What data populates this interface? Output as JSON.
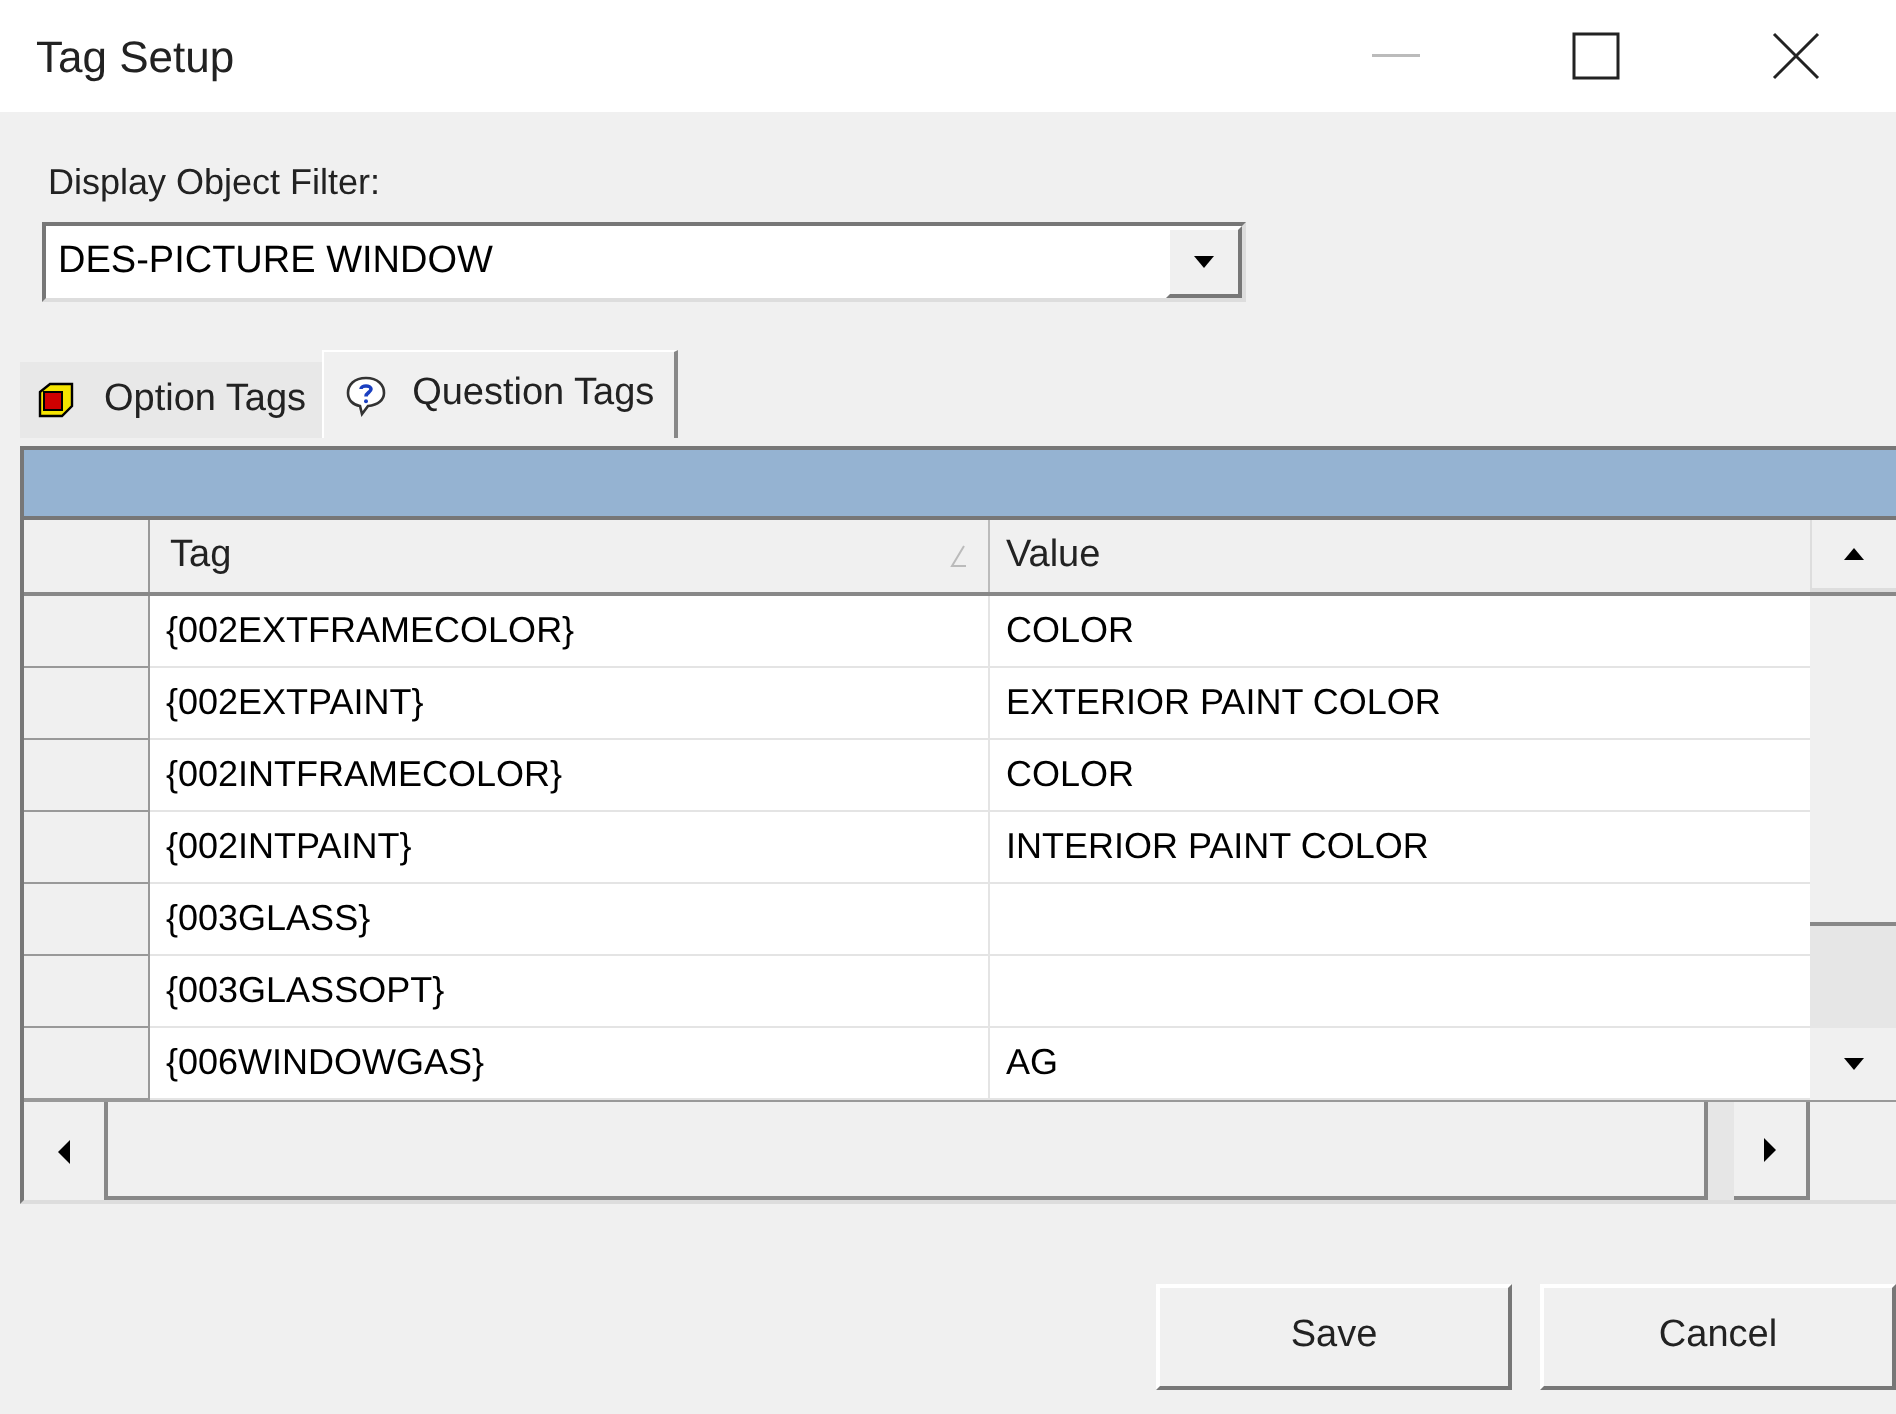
{
  "window": {
    "title": "Tag Setup"
  },
  "filter": {
    "label": "Display Object Filter:",
    "value": "DES-PICTURE WINDOW"
  },
  "tabs": [
    {
      "label": "Option Tags",
      "kind": "option",
      "selected": false
    },
    {
      "label": "Question Tags",
      "kind": "question",
      "selected": true
    }
  ],
  "table": {
    "columns": [
      "Tag",
      "Value"
    ],
    "rows": [
      {
        "tag": "{002EXTFRAMECOLOR}",
        "value": "COLOR"
      },
      {
        "tag": "{002EXTPAINT}",
        "value": "EXTERIOR PAINT COLOR"
      },
      {
        "tag": "{002INTFRAMECOLOR}",
        "value": "COLOR"
      },
      {
        "tag": "{002INTPAINT}",
        "value": "INTERIOR PAINT COLOR"
      },
      {
        "tag": "{003GLASS}"
      },
      {
        "tag": "{003GLASSOPT}"
      },
      {
        "tag": "{006WINDOWGAS}",
        "value": "AG"
      }
    ]
  },
  "buttons": [
    "Save",
    "Cancel"
  ]
}
